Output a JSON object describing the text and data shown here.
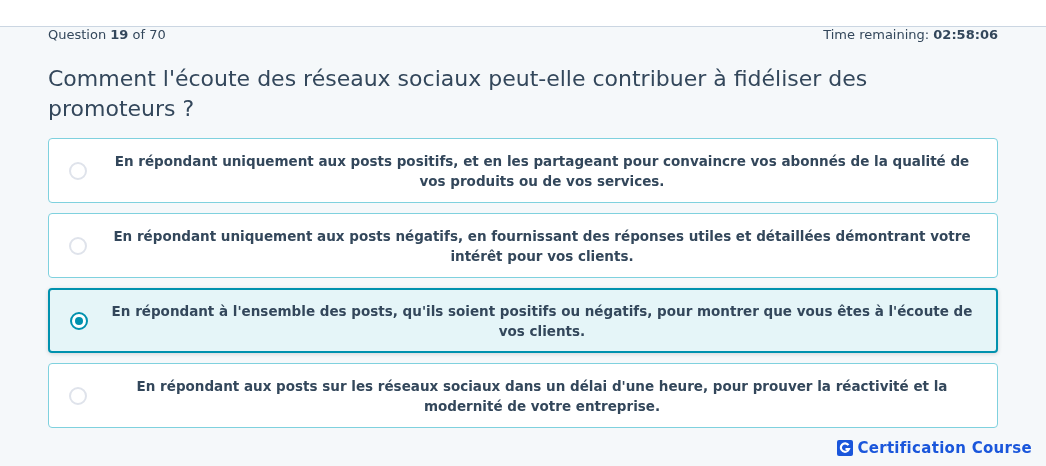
{
  "progress": {
    "question": "Question **19** of 70",
    "time": "Time remaining: **02:58:06**"
  },
  "question": "Comment l'écoute des réseaux sociaux peut-elle contribuer à fidéliser des promoteurs ?",
  "options": [
    {
      "text": "En répondant uniquement aux posts positifs, et en les partageant pour convaincre vos abonnés de la qualité de vos produits ou de vos services.",
      "selected": false
    },
    {
      "text": "En répondant uniquement aux posts négatifs, en fournissant des réponses utiles et détaillées démontrant votre intérêt pour vos clients.",
      "selected": false
    },
    {
      "text": "En répondant à l'ensemble des posts, qu'ils soient positifs ou négatifs, pour montrer que vous êtes à l'écoute de vos clients.",
      "selected": true
    },
    {
      "text": "En répondant aux posts sur les réseaux sociaux dans un délai d'une heure, pour prouver la réactivité et la modernité de votre entreprise.",
      "selected": false
    }
  ],
  "brand": "Certification Course"
}
